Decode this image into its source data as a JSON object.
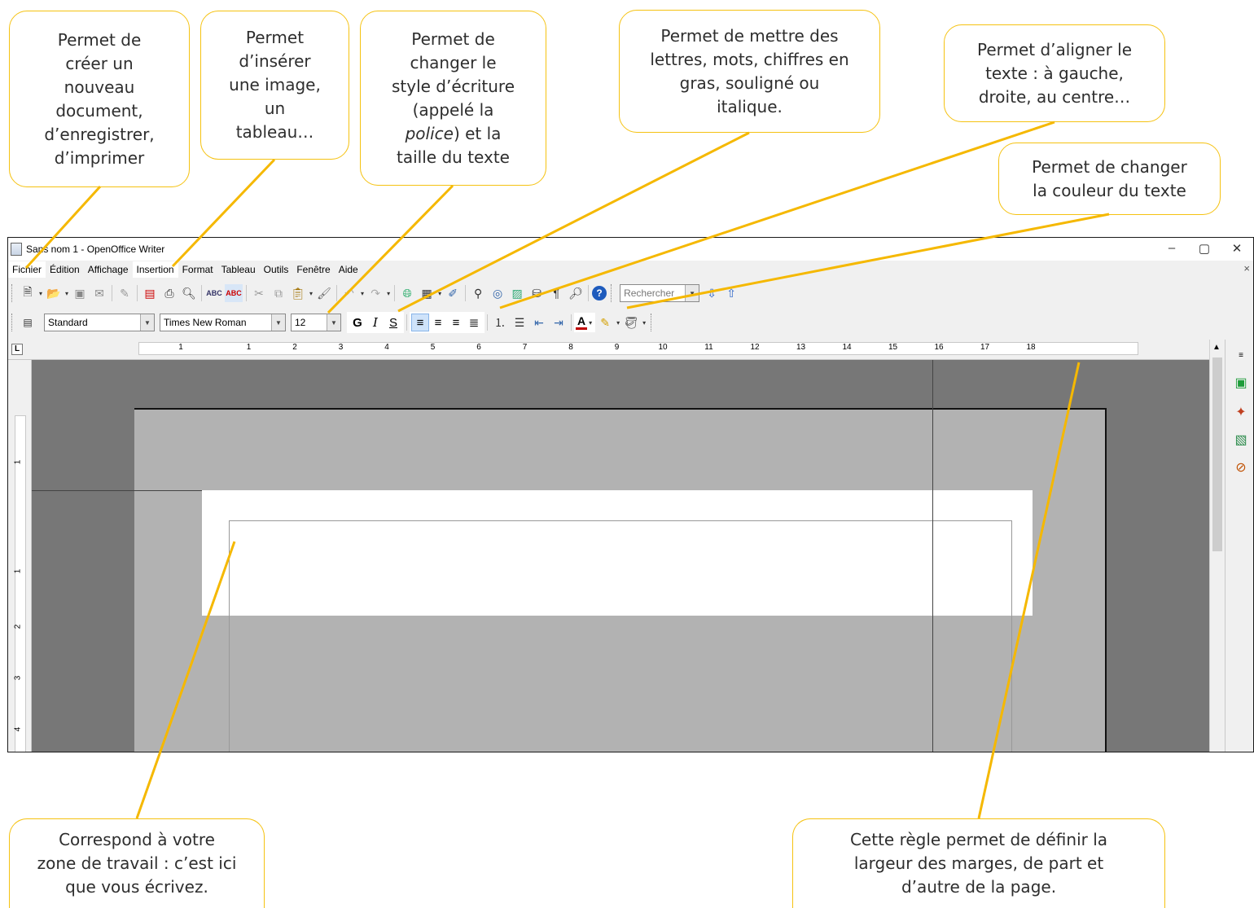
{
  "callouts": {
    "new_doc": "Permet de\ncréer un\nnouveau\ndocument,\nd’enregistrer,\nd’imprimer",
    "insert": "Permet\nd’insérer\nune image,\nun\ntableau…",
    "font": "Permet de\nchanger le\nstyle d’écriture\n(appelé la\n police) et la\ntaille du texte",
    "font_italic_word": "police",
    "bold": "Permet de mettre des\nlettres, mots, chiffres en\ngras, souligné ou\nitalique.",
    "align": "Permet d’aligner le\ntexte : à gauche,\ndroite, au centre…",
    "color": "Permet de changer\nla couleur du texte",
    "workzone": "Correspond à votre\nzone de travail : c’est ici\nque vous écrivez.",
    "ruler": "Cette règle permet de définir la\nlargeur des marges, de part et\nd’autre de la page."
  },
  "window": {
    "title": "Sans nom 1 - OpenOffice Writer",
    "controls": {
      "minimize": "–",
      "restore": "▢",
      "close": "✕"
    },
    "menu_close": "×"
  },
  "menu": [
    "Fichier",
    "Édition",
    "Affichage",
    "Insertion",
    "Format",
    "Tableau",
    "Outils",
    "Fenêtre",
    "Aide"
  ],
  "toolbar_standard": {
    "search_placeholder": "Rechercher"
  },
  "toolbar_format": {
    "style": "Standard",
    "font": "Times New Roman",
    "size": "12",
    "bold": "G",
    "italic": "I",
    "underline": "S",
    "font_color_letter": "A"
  },
  "ruler": {
    "corner": "L",
    "h_numbers": [
      "1",
      "1",
      "2",
      "3",
      "4",
      "5",
      "6",
      "7",
      "8",
      "9",
      "10",
      "11",
      "12",
      "13",
      "14",
      "15",
      "16",
      "17",
      "18"
    ],
    "v_numbers": [
      "1",
      "1",
      "2",
      "3",
      "4"
    ]
  },
  "colors": {
    "callout_border": "#f5c211",
    "connector": "#f5b800",
    "doc_background": "#777777",
    "page": "#b2b2b2",
    "font_color_bar": "#c00000"
  },
  "icons": {
    "toolbar_standard": [
      "new-icon",
      "open-icon",
      "save-icon",
      "email-icon",
      "edit-icon",
      "pdf-icon",
      "print-icon",
      "preview-icon",
      "spellcheck-icon",
      "autospell-icon",
      "cut-icon",
      "copy-icon",
      "paste-icon",
      "clone-icon",
      "undo-icon",
      "redo-icon",
      "hyperlink-icon",
      "table-icon",
      "draw-icon",
      "find-icon",
      "navigator-icon",
      "gallery-icon",
      "datasource-icon",
      "pilcrow-icon",
      "zoom-icon",
      "help-icon"
    ],
    "sidebar": [
      "properties-icon",
      "styles-icon",
      "gallery-icon",
      "navigator-icon"
    ]
  }
}
